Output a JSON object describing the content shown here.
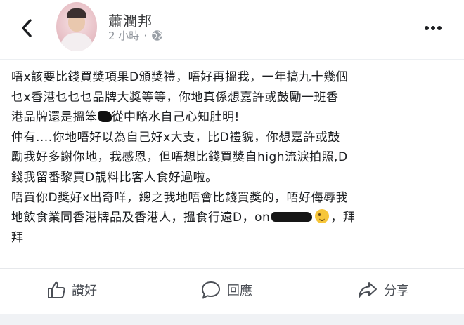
{
  "header": {
    "back_icon": "back-chevron-icon",
    "name": "蕭潤邦",
    "timestamp": "2 小時",
    "separator": "·",
    "privacy_icon": "globe-icon",
    "more_icon": "more-options-icon"
  },
  "post": {
    "lines": [
      "唔x該要比錢買獎項果D頒獎禮，唔好再搵我，一年搞九十幾個",
      "乜x香港乜乜乜品牌大獎等等，你地真係想嘉許或鼓勵一班香",
      "港品牌還是搵笨",
      "從中略水自己心知肚明!",
      "仲有....你地唔好以為自己好x大支，比D禮貌，你想嘉許或鼓",
      "勵我好多謝你地，我感恩，但唔想比錢買獎自high流淚拍照,D",
      "錢我留番黎買D靚料比客人食好過啦。",
      "唔買你D獎好x出奇咩，總之我地唔會比錢買獎的，唔好侮辱我",
      "地飲食業同香港牌品及香港人，搵食行遠D，on",
      "，拜",
      "拜"
    ]
  },
  "actions": {
    "like_label": "讚好",
    "comment_label": "回應",
    "share_label": "分享"
  },
  "colors": {
    "text": "#1c1e21",
    "secondary": "#8f949b",
    "action": "#4b4f56"
  }
}
